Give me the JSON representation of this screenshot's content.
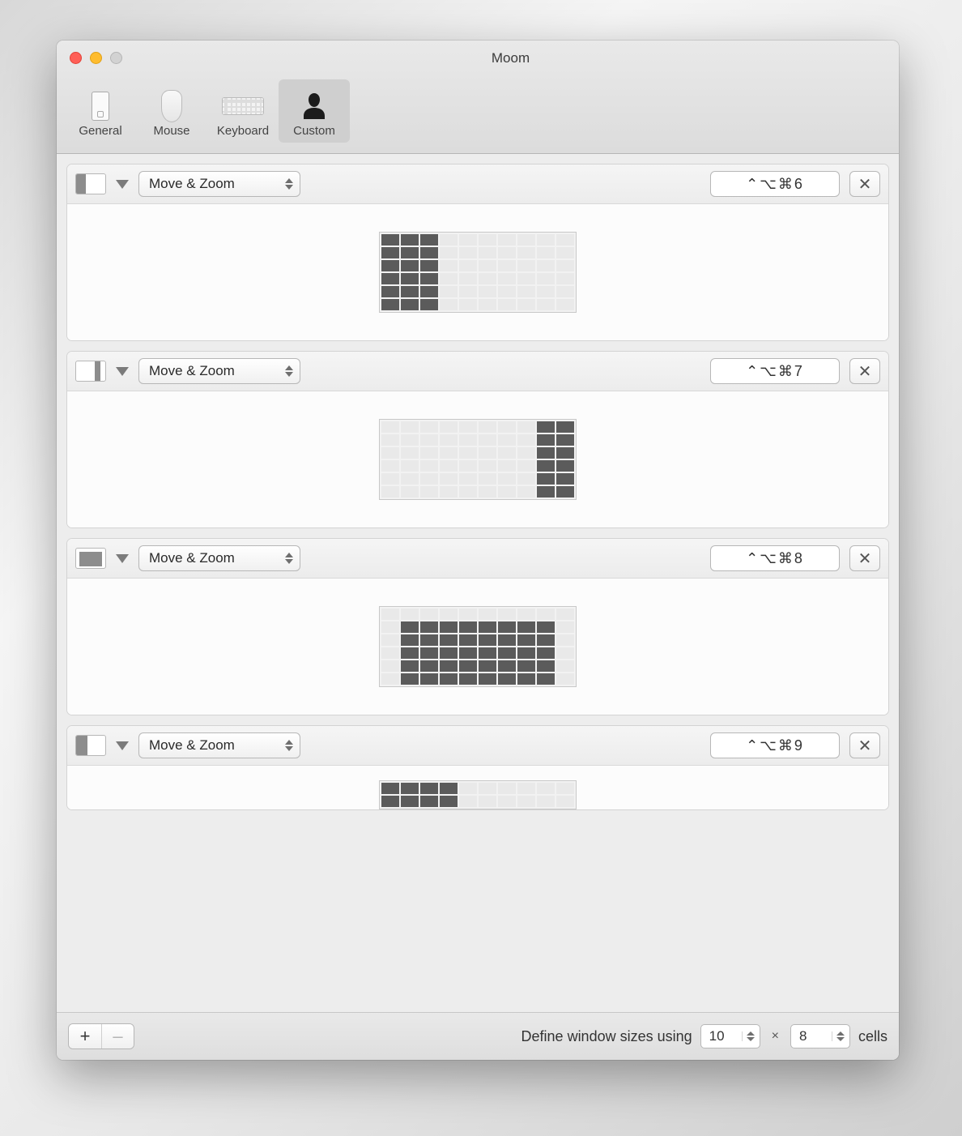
{
  "window": {
    "title": "Moom"
  },
  "toolbar": {
    "general": "General",
    "mouse": "Mouse",
    "keyboard": "Keyboard",
    "custom": "Custom",
    "selected": "custom"
  },
  "grid": {
    "cols": 10,
    "rows": 6
  },
  "rows": [
    {
      "action": "Move & Zoom",
      "shortcut": "⌃⌥⌘6",
      "thumb": {
        "left": 0,
        "top": 0,
        "width": 0.33,
        "height": 1
      },
      "cells": {
        "col_start": 0,
        "col_end": 3,
        "row_start": 0,
        "row_end": 6
      }
    },
    {
      "action": "Move & Zoom",
      "shortcut": "⌃⌥⌘7",
      "thumb": {
        "left": 0.65,
        "top": 0,
        "width": 0.18,
        "height": 1
      },
      "cells": {
        "col_start": 8,
        "col_end": 10,
        "row_start": 0,
        "row_end": 6
      }
    },
    {
      "action": "Move & Zoom",
      "shortcut": "⌃⌥⌘8",
      "thumb": {
        "left": 0.1,
        "top": 0.18,
        "width": 0.8,
        "height": 0.72
      },
      "cells": {
        "col_start": 1,
        "col_end": 9,
        "row_start": 1,
        "row_end": 6
      }
    },
    {
      "action": "Move & Zoom",
      "shortcut": "⌃⌥⌘9",
      "thumb": {
        "left": 0,
        "top": 0,
        "width": 0.4,
        "height": 1
      },
      "cells": {
        "col_start": 0,
        "col_end": 4,
        "row_start": 0,
        "row_end": 2
      },
      "truncated": true
    }
  ],
  "bottom": {
    "add": "+",
    "remove": "–",
    "label": "Define window sizes using",
    "cols": "10",
    "rows": "8",
    "mult": "×",
    "suffix": "cells"
  }
}
